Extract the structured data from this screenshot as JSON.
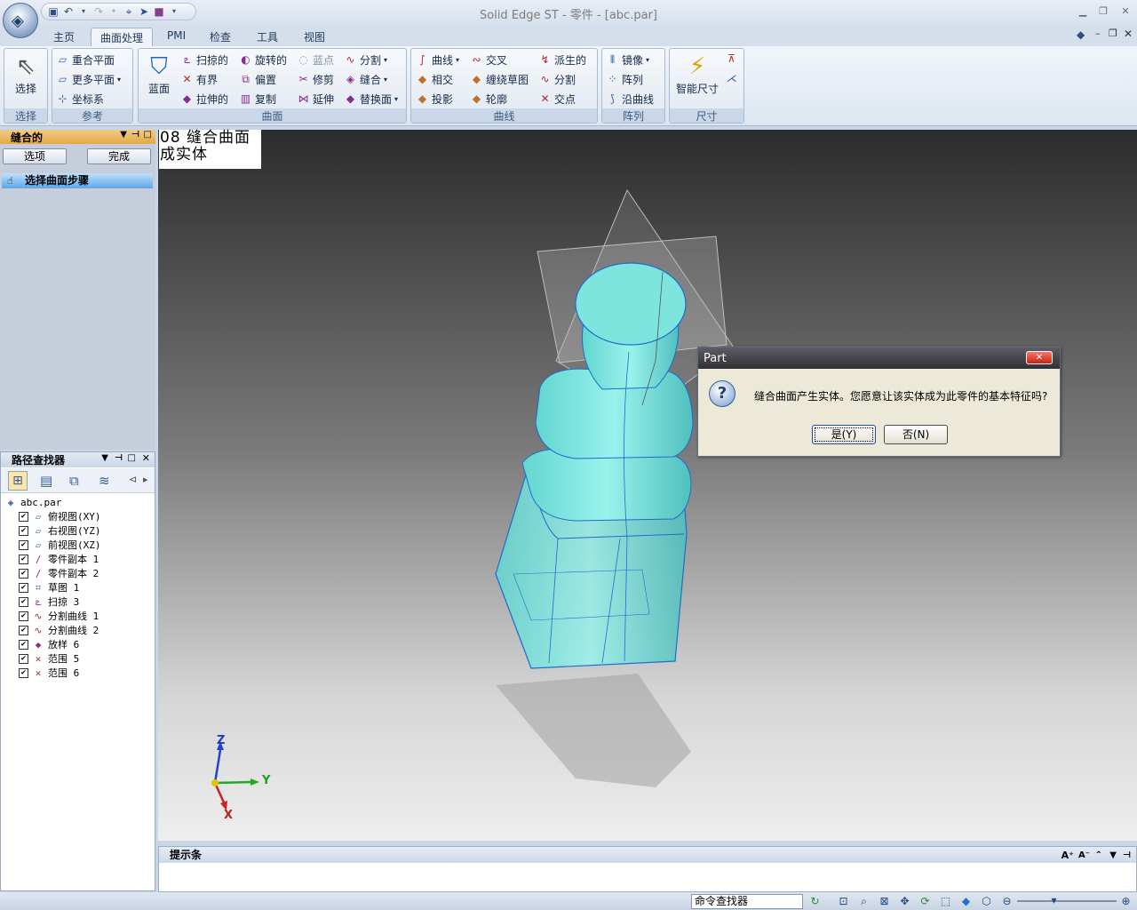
{
  "window": {
    "title": "Solid Edge ST - 零件 - [abc.par]"
  },
  "ribbon_tabs": [
    "主页",
    "曲面处理",
    "PMI",
    "检查",
    "工具",
    "视图"
  ],
  "ribbon": {
    "select": {
      "button": "选择",
      "group": "选择"
    },
    "reference": {
      "items": [
        "重合平面",
        "更多平面",
        "坐标系"
      ],
      "group": "参考"
    },
    "surface": {
      "big": "蓝面",
      "col1": [
        "扫掠的",
        "有界",
        "拉伸的"
      ],
      "col2": [
        "旋转的",
        "偏置",
        "复制"
      ],
      "col3": [
        "蓝点",
        "修剪",
        "延伸"
      ],
      "col4": [
        "分割",
        "缝合",
        "替换面"
      ],
      "group": "曲面"
    },
    "curves": {
      "col1": [
        "曲线",
        "相交",
        "投影"
      ],
      "col2": [
        "交叉",
        "缠绕草图",
        "轮廓"
      ],
      "col3": [
        "派生的",
        "分割",
        "交点"
      ],
      "group": "曲线"
    },
    "pattern": {
      "items": [
        "镜像",
        "阵列",
        "沿曲线"
      ],
      "group": "阵列"
    },
    "dimension": {
      "button": "智能尺寸",
      "group": "尺寸"
    }
  },
  "command_pane": {
    "title": "缝合的",
    "options_button": "选项",
    "finish_button": "完成",
    "step": "选择曲面步骤"
  },
  "path_finder": {
    "title": "路径查找器",
    "root": "abc.par",
    "items": [
      {
        "label": "俯视图(XY)",
        "icon": "plane-icon",
        "checked": true
      },
      {
        "label": "右视图(YZ)",
        "icon": "plane-icon",
        "checked": true
      },
      {
        "label": "前视图(XZ)",
        "icon": "plane-icon",
        "checked": true
      },
      {
        "label": "零件副本 1",
        "icon": "part-copy-icon",
        "checked": true
      },
      {
        "label": "零件副本 2",
        "icon": "part-copy-icon",
        "checked": true
      },
      {
        "label": "草图 1",
        "icon": "sketch-icon",
        "checked": true
      },
      {
        "label": "扫掠 3",
        "icon": "sweep-icon",
        "checked": true
      },
      {
        "label": "分割曲线 1",
        "icon": "split-curve-icon",
        "checked": true
      },
      {
        "label": "分割曲线 2",
        "icon": "split-curve-icon",
        "checked": true
      },
      {
        "label": "放样 6",
        "icon": "loft-icon",
        "checked": true
      },
      {
        "label": "范围 5",
        "icon": "bounded-icon",
        "checked": true
      },
      {
        "label": "范围 6",
        "icon": "bounded-icon",
        "checked": true
      }
    ]
  },
  "viewport": {
    "note": "08 缝合曲面成实体",
    "axes": {
      "z": "Z",
      "y": "Y",
      "x": "X"
    }
  },
  "dialog": {
    "title": "Part",
    "message": "缝合曲面产生实体。您愿意让该实体成为此零件的基本特征吗?",
    "yes": "是(Y)",
    "no": "否(N)"
  },
  "prompt_bar": {
    "title": "提示条"
  },
  "status": {
    "command_finder": "命令查找器"
  }
}
